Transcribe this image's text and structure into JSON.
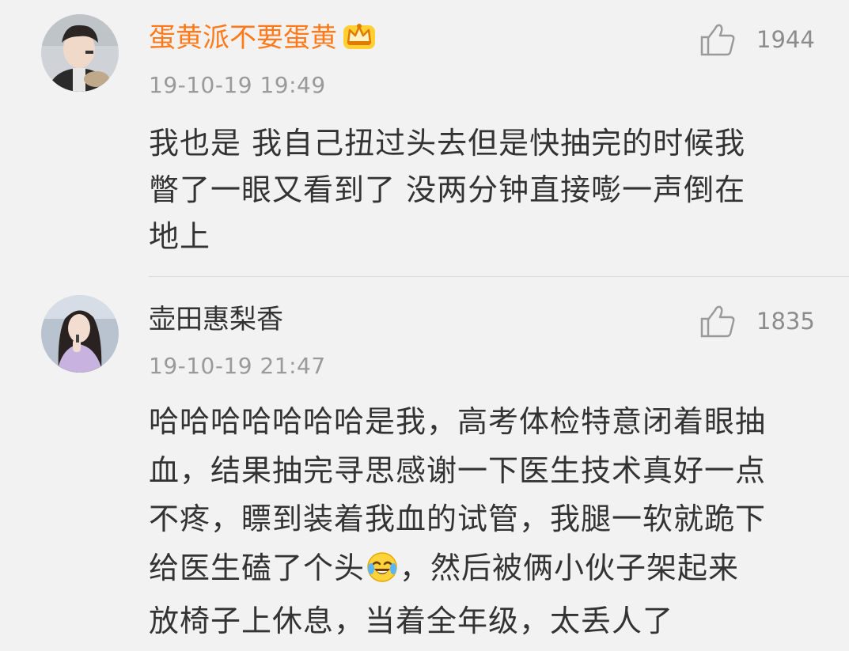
{
  "colors": {
    "username_highlight": "#ff7a1a",
    "username_normal": "#333333",
    "timestamp": "#9a9a9a",
    "text": "#333333"
  },
  "comments": [
    {
      "username": "蛋黄派不要蛋黄",
      "badge_icon": "crown-icon",
      "timestamp": "19-10-19 19:49",
      "likes": "1944",
      "lines": [
        "我也是 我自己扭过头去但是快抽完的时候我",
        "瞥了一眼又看到了 没两分钟直接嘭一声倒在",
        "地上"
      ]
    },
    {
      "username": "壶田惠梨香",
      "timestamp": "19-10-19 21:47",
      "likes": "1835",
      "lines": [
        "哈哈哈哈哈哈哈是我，高考体检特意闭着眼抽",
        "血，结果抽完寻思感谢一下医生技术真好一点",
        "不疼，瞟到装着我血的试管，我腿一软就跪下",
        "给医生磕了个头",
        "，然后被俩小伙子架起来",
        "放椅子上休息，当着全年级，太丢人了"
      ],
      "inline_emoji": "laughing-crying-emoji-icon"
    }
  ]
}
